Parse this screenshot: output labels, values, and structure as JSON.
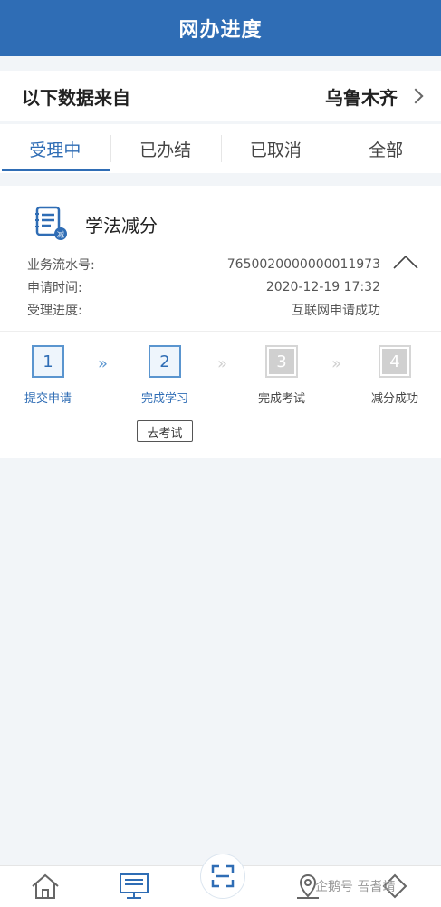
{
  "header": {
    "title": "网办进度"
  },
  "source": {
    "label": "以下数据来自",
    "city": "乌鲁木齐"
  },
  "tabs": [
    {
      "label": "受理中",
      "active": true
    },
    {
      "label": "已办结",
      "active": false
    },
    {
      "label": "已取消",
      "active": false
    },
    {
      "label": "全部",
      "active": false
    }
  ],
  "card": {
    "title": "学法减分",
    "icon_badge": "减",
    "rows": [
      {
        "key": "业务流水号:",
        "value": "7650020000000011973"
      },
      {
        "key": "申请时间:",
        "value": "2020-12-19 17:32"
      },
      {
        "key": "受理进度:",
        "value": "互联网申请成功"
      }
    ],
    "steps": [
      {
        "num": "1",
        "label": "提交申请",
        "state": "done"
      },
      {
        "num": "2",
        "label": "完成学习",
        "state": "done"
      },
      {
        "num": "3",
        "label": "完成考试",
        "state": "todo"
      },
      {
        "num": "4",
        "label": "减分成功",
        "state": "todo"
      }
    ],
    "arrow_glyph": "»",
    "action_label": "去考试"
  },
  "watermark": "企鹅号 吾耆靖",
  "colors": {
    "primary": "#2f6db5",
    "step_done": "#5a95cf",
    "step_todo": "#d0d0d0",
    "background": "#f2f5f8"
  }
}
